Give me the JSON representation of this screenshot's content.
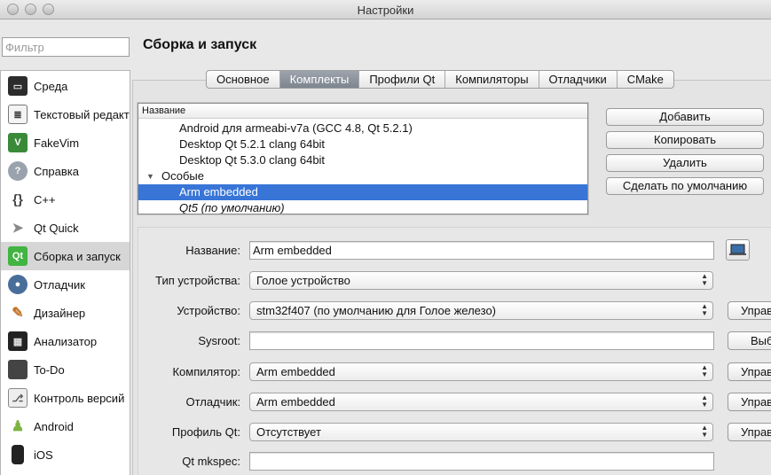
{
  "window": {
    "title": "Настройки"
  },
  "filter": {
    "placeholder": "Фильтр",
    "value": ""
  },
  "sidebar": {
    "items": [
      {
        "label": "Среда",
        "icon": "environment-icon"
      },
      {
        "label": "Текстовый редактор",
        "icon": "text-editor-icon"
      },
      {
        "label": "FakeVim",
        "icon": "fakevim-icon"
      },
      {
        "label": "Справка",
        "icon": "help-icon"
      },
      {
        "label": "C++",
        "icon": "cpp-icon"
      },
      {
        "label": "Qt Quick",
        "icon": "qt-quick-icon"
      },
      {
        "label": "Сборка и запуск",
        "icon": "qt-build-icon",
        "selected": true
      },
      {
        "label": "Отладчик",
        "icon": "debugger-icon"
      },
      {
        "label": "Дизайнер",
        "icon": "designer-icon"
      },
      {
        "label": "Анализатор",
        "icon": "analyzer-icon"
      },
      {
        "label": "To-Do",
        "icon": "todo-icon"
      },
      {
        "label": "Контроль версий",
        "icon": "version-control-icon"
      },
      {
        "label": "Android",
        "icon": "android-icon"
      },
      {
        "label": "iOS",
        "icon": "ios-icon"
      }
    ]
  },
  "page": {
    "title": "Сборка и запуск"
  },
  "tabs": [
    {
      "label": "Основное",
      "active": false
    },
    {
      "label": "Комплекты",
      "active": true
    },
    {
      "label": "Профили Qt",
      "active": false
    },
    {
      "label": "Компиляторы",
      "active": false
    },
    {
      "label": "Отладчики",
      "active": false
    },
    {
      "label": "CMake",
      "active": false
    }
  ],
  "kits": {
    "header": "Название",
    "rows": [
      {
        "label": "Android для armeabi-v7a (GCC 4.8, Qt 5.2.1)"
      },
      {
        "label": "Desktop Qt 5.2.1 clang 64bit"
      },
      {
        "label": "Desktop Qt 5.3.0 clang 64bit"
      },
      {
        "label": "Особые",
        "group": true
      },
      {
        "label": "Arm embedded",
        "selected": true
      },
      {
        "label": "Qt5 (по умолчанию)",
        "italic": true
      }
    ]
  },
  "buttons": {
    "add": "Добавить",
    "copy": "Копировать",
    "remove": "Удалить",
    "make_default": "Сделать по умолчанию"
  },
  "form": {
    "name_label": "Название:",
    "name_value": "Arm embedded",
    "device_type_label": "Тип устройства:",
    "device_type_value": "Голое устройство",
    "device_label": "Устройство:",
    "device_value": "stm32f407 (по умолчанию для Голое железо)",
    "device_manage": "Управление...",
    "sysroot_label": "Sysroot:",
    "sysroot_value": "",
    "sysroot_browse": "Выбрать...",
    "compiler_label": "Компилятор:",
    "compiler_value": "Arm embedded",
    "compiler_manage": "Управление...",
    "debugger_label": "Отладчик:",
    "debugger_value": "Arm embedded",
    "debugger_manage": "Управление...",
    "qt_profile_label": "Профиль Qt:",
    "qt_profile_value": "Отсутствует",
    "qt_profile_manage": "Управление...",
    "mkspec_label": "Qt mkspec:",
    "mkspec_value": ""
  }
}
